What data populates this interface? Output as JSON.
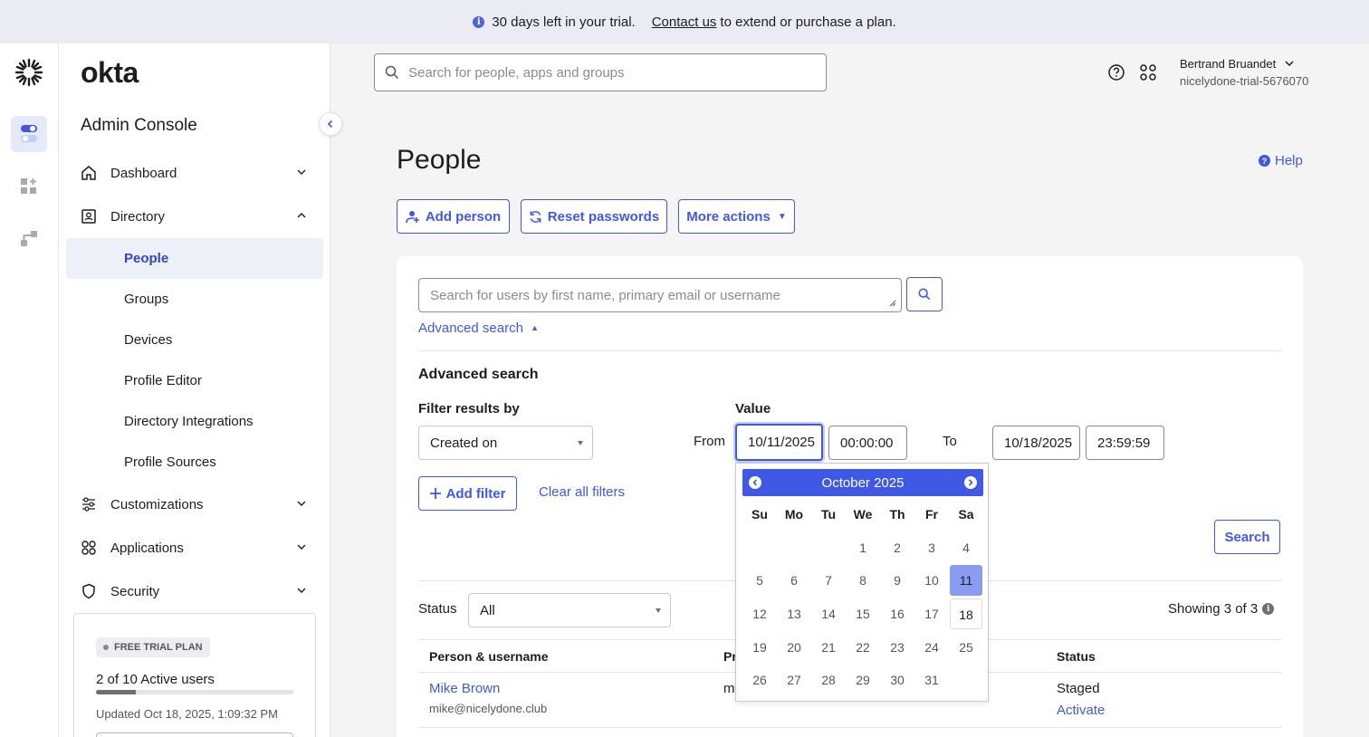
{
  "banner": {
    "message": "30 days left in your trial.",
    "link": "Contact us",
    "suffix": "to extend or purchase a plan."
  },
  "brand": {
    "logo": "okta",
    "console_title": "Admin Console"
  },
  "topbar": {
    "search_placeholder": "Search for people, apps and groups",
    "user_name": "Bertrand Bruandet",
    "org": "nicelydone-trial-5676070"
  },
  "sidebar": {
    "items": [
      {
        "label": "Dashboard",
        "icon": "home-icon"
      },
      {
        "label": "Directory",
        "icon": "directory-icon"
      },
      {
        "label": "Customizations",
        "icon": "sliders-icon"
      },
      {
        "label": "Applications",
        "icon": "apps-icon"
      },
      {
        "label": "Security",
        "icon": "shield-icon"
      }
    ],
    "directory_sub": [
      "People",
      "Groups",
      "Devices",
      "Profile Editor",
      "Directory Integrations",
      "Profile Sources"
    ]
  },
  "trial": {
    "badge": "FREE TRIAL PLAN",
    "active_users": "2 of 10 Active users",
    "active_fraction": 0.2,
    "updated": "Updated Oct 18, 2025, 1:09:32 PM"
  },
  "page": {
    "title": "People",
    "help": "Help",
    "add_person": "Add person",
    "reset_passwords": "Reset passwords",
    "more_actions": "More actions"
  },
  "search": {
    "placeholder": "Search for users by first name, primary email or username",
    "advanced_toggle": "Advanced search",
    "section_title": "Advanced search",
    "filter_label": "Filter results by",
    "filter_value": "Created on",
    "value_label": "Value",
    "from_label": "From",
    "from_date": "10/11/2025",
    "from_time": "00:00:00",
    "to_label": "To",
    "to_date": "10/18/2025",
    "to_time": "23:59:59",
    "add_filter": "Add filter",
    "clear_filters": "Clear all filters",
    "search_button": "Search"
  },
  "results": {
    "status_label": "Status",
    "status_value": "All",
    "showing": "Showing 3 of 3",
    "columns": [
      "Person & username",
      "Pr",
      "Status"
    ],
    "rows": [
      {
        "name": "Mike Brown",
        "email": "mike@nicelydone.club",
        "primary": "m",
        "status": "Staged",
        "action": "Activate"
      }
    ]
  },
  "datepicker": {
    "month": "October 2025",
    "weekdays": [
      "Su",
      "Mo",
      "Tu",
      "We",
      "Th",
      "Fr",
      "Sa"
    ],
    "first_weekday": 3,
    "days_in_month": 31,
    "selected": 11,
    "range_end": 18
  },
  "colors": {
    "accent": "#3f59e4",
    "selected_day": "#8b9cf0",
    "banner_bg": "#ebebf4"
  }
}
